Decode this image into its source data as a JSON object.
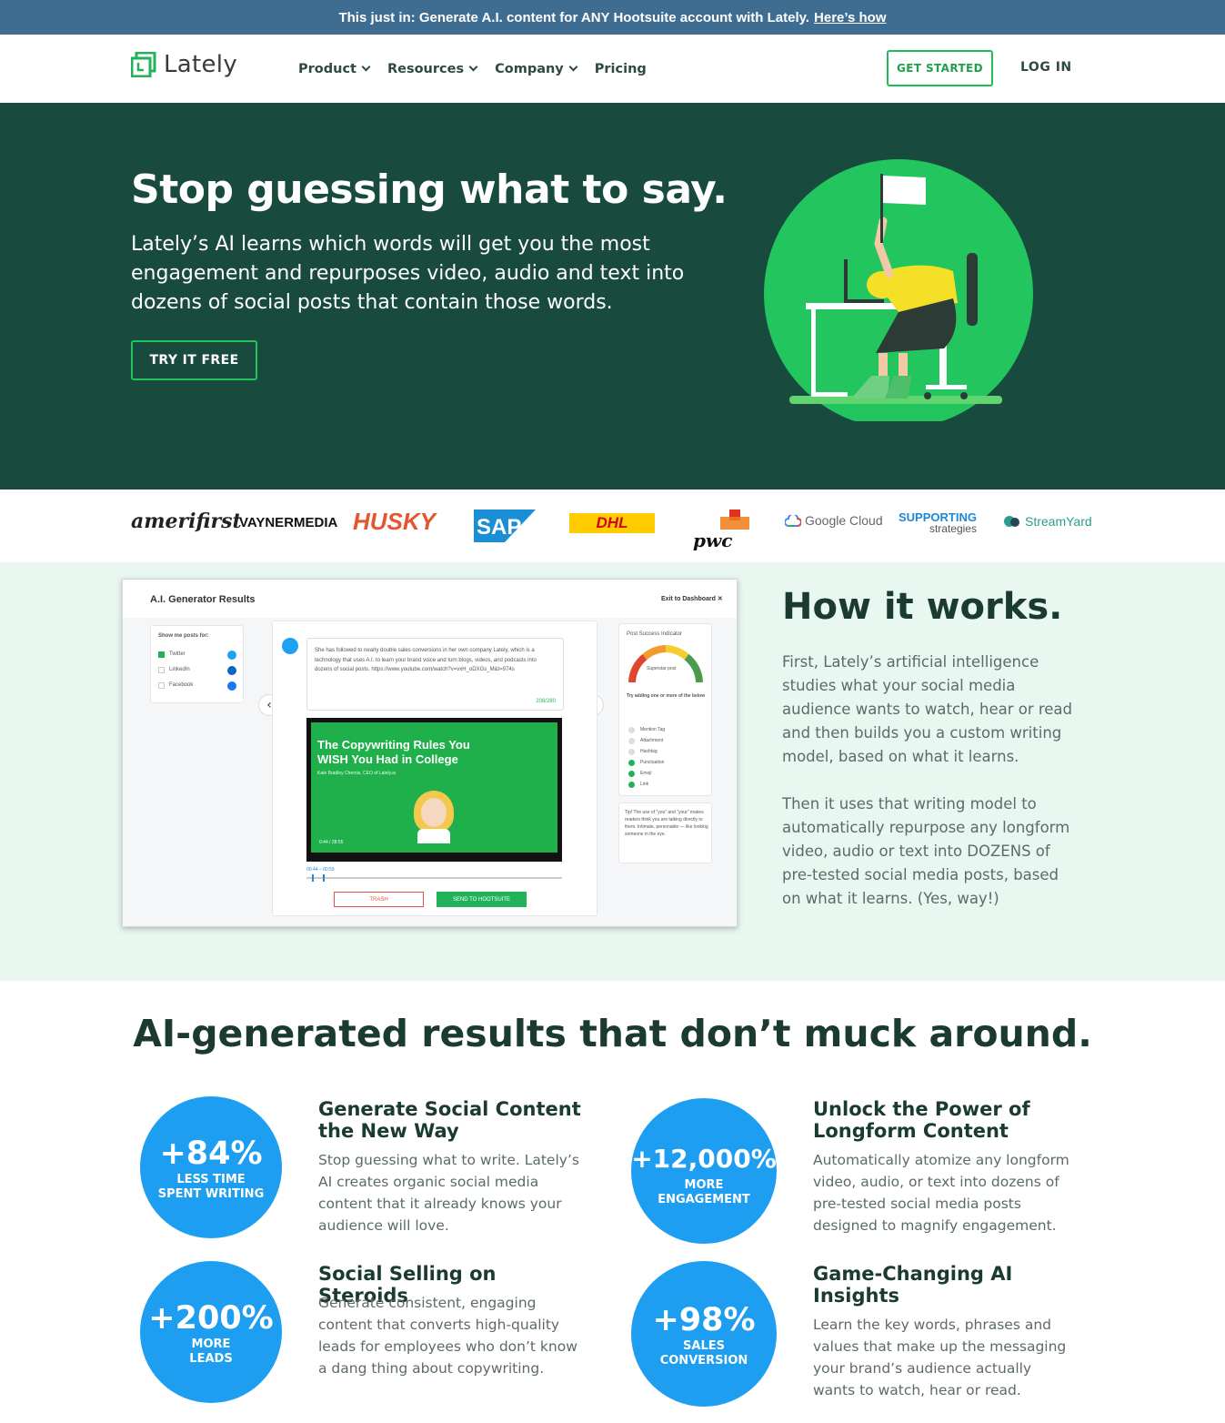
{
  "announcement": {
    "text": "This just in: Generate A.I. content for ANY Hootsuite account with Lately.",
    "link": "Here’s how"
  },
  "nav": {
    "logo": "Lately",
    "menu": [
      {
        "label": "Product",
        "has_dropdown": true
      },
      {
        "label": "Resources",
        "has_dropdown": true
      },
      {
        "label": "Company",
        "has_dropdown": true
      },
      {
        "label": "Pricing",
        "has_dropdown": false
      }
    ],
    "get_started": "GET STARTED",
    "login": "LOG IN"
  },
  "hero": {
    "title": "Stop guessing what to say.",
    "subtitle": "Lately’s AI learns which words will get you the most engagement and repurposes video, audio and text into dozens of social posts that contain those words.",
    "cta": "TRY IT FREE"
  },
  "brands": [
    "amerifirst",
    "VAYNERMEDIA",
    "HUSKY",
    "SAP",
    "DHL",
    "pwc",
    "Google Cloud",
    "SUPPORTING",
    "strategies",
    "StreamYard"
  ],
  "how": {
    "title": "How it works.",
    "p1": "First, Lately’s artificial intelligence studies what your social media audience wants to watch, hear or read and then builds you a custom writing model, based on what it learns.",
    "p2": "Then it uses that writing model to automatically repurpose any longform video, audio or text into DOZENS of pre-tested social media posts, based on what it learns. (Yes, way!)",
    "mock": {
      "title": "A.I. Generator Results",
      "exit": "Exit to Dashboard",
      "show_posts_for": "Show me posts for:",
      "channels": [
        {
          "name": "Twitter",
          "checked": true
        },
        {
          "name": "LinkedIn",
          "checked": false
        },
        {
          "name": "Facebook",
          "checked": false
        }
      ],
      "post_text": "She has followed to nearly double sales conversions in her own company Lately, which is a technology that uses A.I. to learn your brand voice and turn blogs, videos, and podcasts into dozens of social posts. https://www.youtube.com/watch?v=vxH_oDXGs_M&t=974s",
      "char_count": "208/280",
      "video_title": "The Copywriting Rules You WISH You Had in College",
      "video_byline": "Kate Bradley Chernis, CEO of Lately.ai",
      "video_time": "0:44 / 28:55",
      "clip_range": "00:44 – 00:59",
      "trash": "TRASH",
      "send": "SEND TO HOOTSUITE",
      "indicator_title": "Post Success Indicator",
      "gauge_label": "Superstar post",
      "try_adding": "Try adding one or more of the below",
      "checklist": [
        {
          "label": "Mention Tag",
          "done": false
        },
        {
          "label": "Attachment",
          "done": false
        },
        {
          "label": "Hashtag",
          "done": false
        },
        {
          "label": "Punctuation",
          "done": true
        },
        {
          "label": "Emoji",
          "done": true
        },
        {
          "label": "Link",
          "done": true
        }
      ],
      "tip": "Tip! The use of \"you\" and \"your\" makes readers think you are talking directly to them. Intimate, personable — like looking someone in the eye."
    }
  },
  "results": {
    "title": "AI-generated results that don’t muck around.",
    "features": [
      {
        "stat": "+84%",
        "stat_label_1": "LESS TIME",
        "stat_label_2": "SPENT WRITING",
        "title": "Generate Social Content the New Way",
        "desc": "Stop guessing what to write. Lately’s AI creates organic social media content that it already knows your audience will love."
      },
      {
        "stat": "+12,000%",
        "stat_label_1": "MORE",
        "stat_label_2": "ENGAGEMENT",
        "title": "Unlock the Power of Longform Content",
        "desc": "Automatically atomize any longform video, audio, or text into dozens of pre-tested social media posts designed to magnify engagement."
      },
      {
        "stat": "+200%",
        "stat_label_1": "MORE",
        "stat_label_2": "LEADS",
        "title": "Social Selling on Steroids",
        "desc": "Generate consistent, engaging content that converts high-quality leads for employees who don’t know a dang thing about copywriting."
      },
      {
        "stat": "+98%",
        "stat_label_1": "SALES",
        "stat_label_2": "CONVERSION",
        "title": "Game-Changing AI Insights",
        "desc": "Learn the key words, phrases and values that make up the messaging your brand’s audience actually wants to watch, hear or read."
      }
    ]
  },
  "colors": {
    "hero_bg": "#194a3e",
    "accent_green": "#22c55e",
    "stat_blue": "#1e9ef0",
    "announce_bg": "#3f6d92",
    "how_bg": "#e9f7f1"
  }
}
